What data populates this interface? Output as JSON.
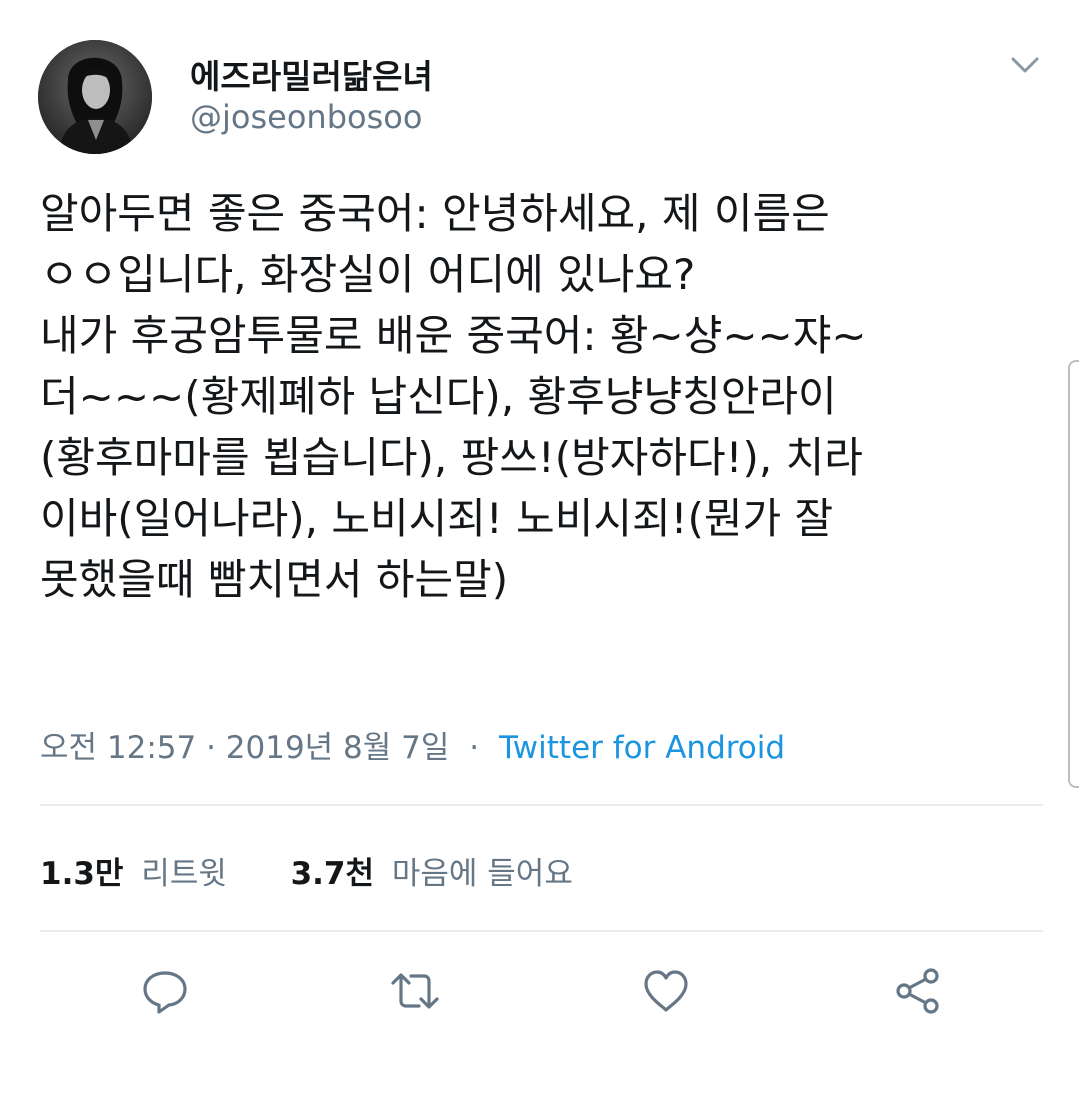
{
  "user": {
    "display_name": "에즈라밀러닮은녀",
    "handle": "@joseonbosoo"
  },
  "tweet": {
    "text": "알아두면 좋은 중국어: 안녕하세요, 제 이름은\nㅇㅇ입니다, 화장실이 어디에 있나요?\n내가 후궁암투물로 배운 중국어: 황~샹~~쟈~\n더~~~(황제폐하 납신다), 황후냥냥칭안라이\n(황후마마를 뵙습니다), 팡쓰!(방자하다!), 치라\n이바(일어나라), 노비시죄! 노비시죄!(뭔가 잘\n못했을때 빰치면서 하는말)",
    "timestamp": "오전 12:57 · 2019년 8월 7일",
    "separator": "·",
    "source": "Twitter for Android"
  },
  "stats": {
    "retweets_count": "1.3만",
    "retweets_label": "리트윗",
    "likes_count": "3.7천",
    "likes_label": "마음에 들어요"
  },
  "icons": {
    "menu": "chevron-down-icon",
    "reply": "reply-icon",
    "retweet": "retweet-icon",
    "like": "heart-icon",
    "share": "share-icon"
  },
  "colors": {
    "text": "#14171a",
    "secondary": "#657786",
    "link": "#1b95e0",
    "divider": "#e6ecf0"
  }
}
